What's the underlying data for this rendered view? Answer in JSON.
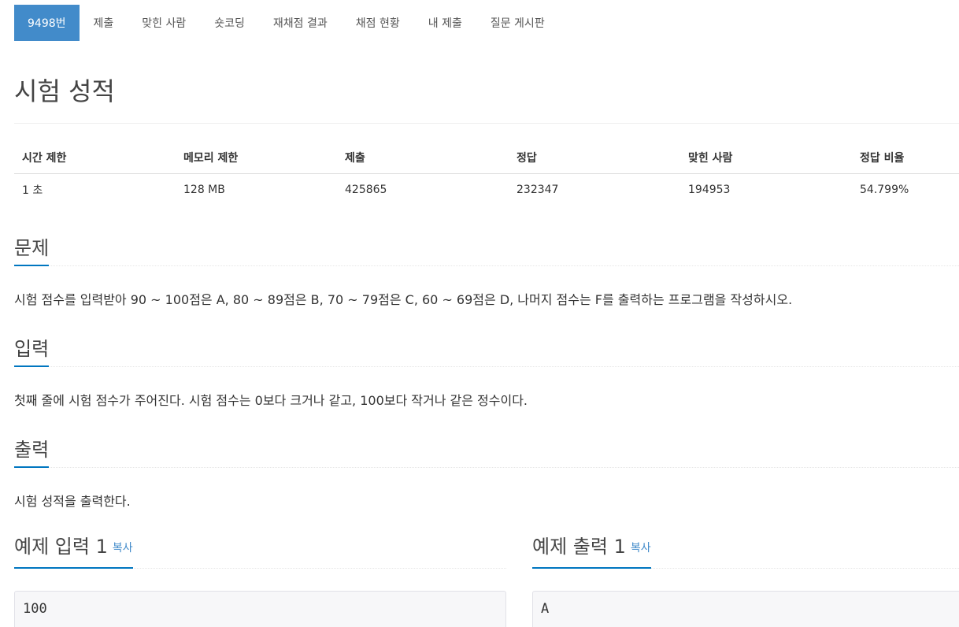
{
  "nav": {
    "tabs": [
      {
        "label": "9498번",
        "active": true
      },
      {
        "label": "제출"
      },
      {
        "label": "맞힌 사람"
      },
      {
        "label": "숏코딩"
      },
      {
        "label": "재채점 결과"
      },
      {
        "label": "채점 현황"
      },
      {
        "label": "내 제출"
      },
      {
        "label": "질문 게시판"
      }
    ]
  },
  "title": "시험 성적",
  "info": {
    "headers": [
      "시간 제한",
      "메모리 제한",
      "제출",
      "정답",
      "맞힌 사람",
      "정답 비율"
    ],
    "values": [
      "1 초",
      "128 MB",
      "425865",
      "232347",
      "194953",
      "54.799%"
    ]
  },
  "problem": {
    "title": "문제",
    "text": "시험 점수를 입력받아 90 ~ 100점은 A, 80 ~ 89점은 B, 70 ~ 79점은 C, 60 ~ 69점은 D, 나머지 점수는 F를 출력하는 프로그램을 작성하시오."
  },
  "input": {
    "title": "입력",
    "text": "첫째 줄에 시험 점수가 주어진다. 시험 점수는 0보다 크거나 같고, 100보다 작거나 같은 정수이다."
  },
  "output": {
    "title": "출력",
    "text": "시험 성적을 출력한다."
  },
  "samples": {
    "input_title": "예제 입력 1",
    "output_title": "예제 출력 1",
    "copy_label": "복사",
    "input_value": "100",
    "output_value": "A"
  },
  "colors": {
    "accent": "#428bca",
    "section_underline": "#0076c0",
    "sample_bg": "#f7f7f9"
  }
}
